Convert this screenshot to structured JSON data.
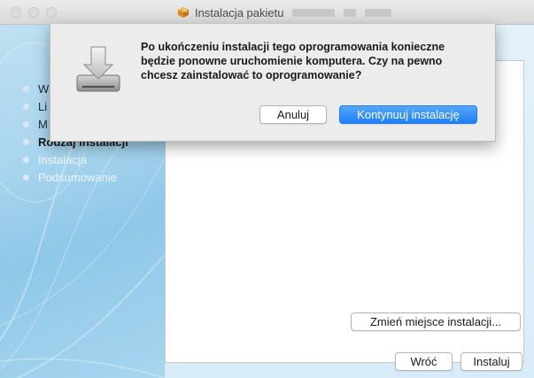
{
  "window": {
    "title": "Instalacja pakietu",
    "title_blurred_name": true,
    "icon": "package-icon"
  },
  "sidebar": {
    "steps": [
      {
        "label": "W",
        "state": "done"
      },
      {
        "label": "Li",
        "state": "done"
      },
      {
        "label": "M",
        "state": "done"
      },
      {
        "label": "Rodzaj instalacji",
        "state": "active"
      },
      {
        "label": "Instalacja",
        "state": "future"
      },
      {
        "label": "Podsumowanie",
        "state": "future"
      }
    ]
  },
  "content": {
    "change_location_label": "Zmień miejsce instalacji...",
    "back_label": "Wróć",
    "install_label": "Instaluj"
  },
  "sheet": {
    "icon": "installer-disk-icon",
    "message": "Po ukończeniu instalacji tego oprogramowania konieczne będzie ponowne uruchomienie komputera. Czy na pewno chcesz zainstalować to oprogramowanie?",
    "cancel_label": "Anuluj",
    "continue_label": "Kontynuuj instalację"
  },
  "colors": {
    "accent": "#1e7ef6",
    "sidebar": "#a9d5ee"
  }
}
